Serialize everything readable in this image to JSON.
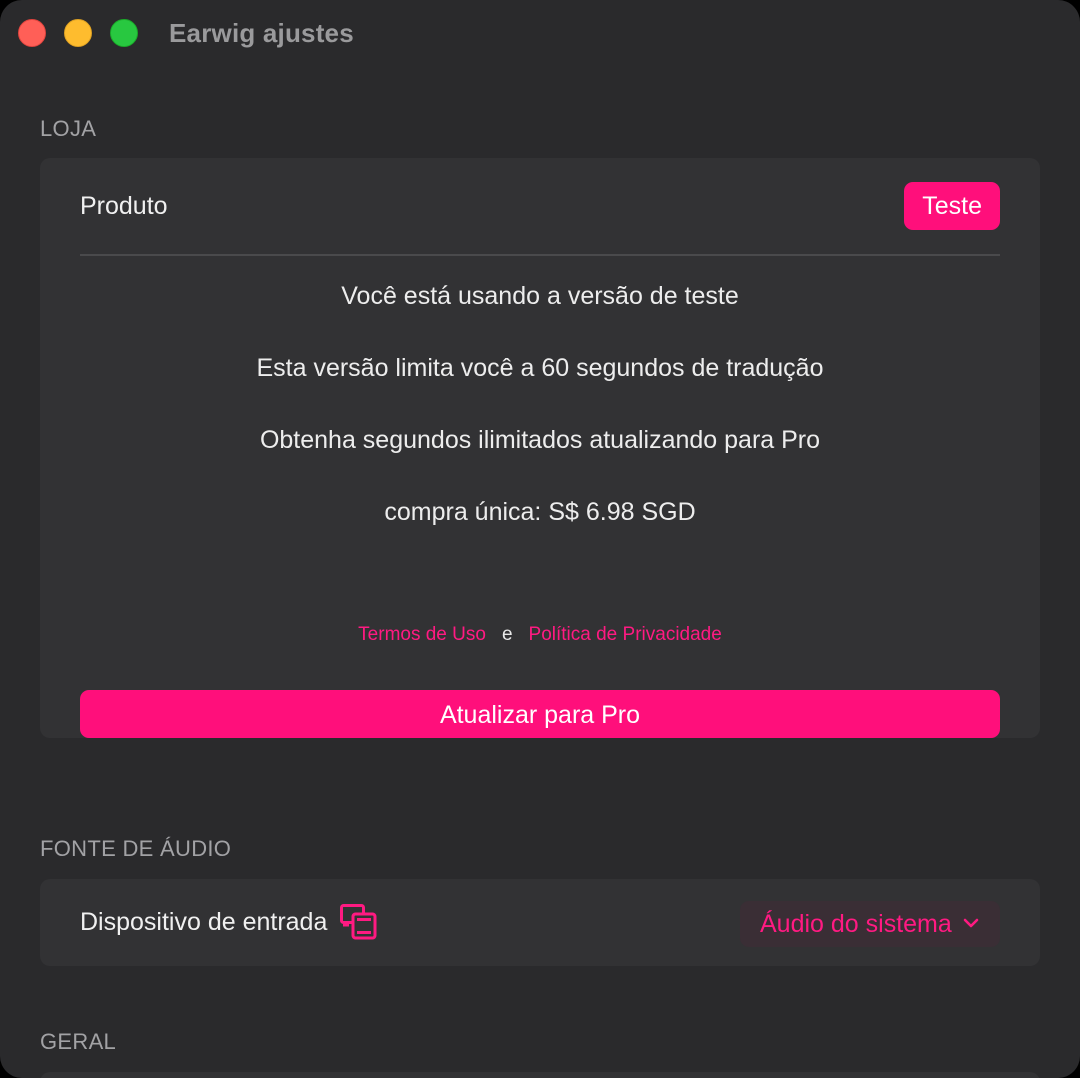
{
  "window": {
    "title": "Earwig ajustes"
  },
  "store": {
    "section_label": "LOJA",
    "product_label": "Produto",
    "status_badge": "Teste",
    "lines": [
      "Você está usando a versão de teste",
      "Esta versão limita você a 60 segundos de tradução",
      "Obtenha segundos ilimitados atualizando para Pro",
      "compra única: S$ 6.98 SGD"
    ],
    "terms_link": "Termos de Uso",
    "links_separator": "e",
    "privacy_link": "Política de Privacidade",
    "upgrade_button": "Atualizar para Pro"
  },
  "audio": {
    "section_label": "FONTE DE ÁUDIO",
    "device_label": "Dispositivo de entrada",
    "device_icon": "screen-devices-icon",
    "selected_source": "Áudio do sistema",
    "dropdown_icon": "chevron-down-icon"
  },
  "general": {
    "section_label": "GERAL"
  },
  "colors": {
    "accent": "#ff0f7b",
    "window_bg": "#2a2a2c",
    "card_bg": "#323234"
  }
}
